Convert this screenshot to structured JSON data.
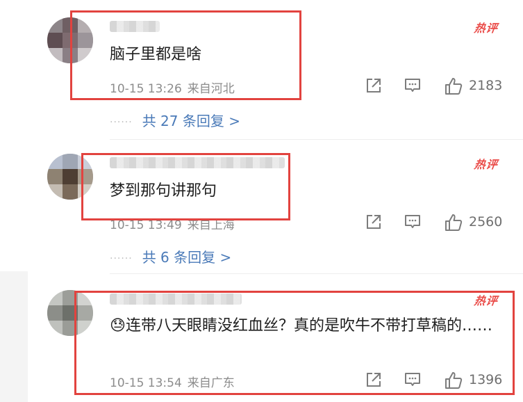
{
  "hot_label": "热评",
  "comments": [
    {
      "content": "脑子里都是啥",
      "time": "10-15 13:26",
      "location": "来自河北",
      "likes": "2183",
      "replies": "共 27 条回复 >"
    },
    {
      "content": "梦到那句讲那句",
      "time": "10-15 13:49",
      "location": "来自上海",
      "likes": "2560",
      "replies": "共 6 条回复 >"
    },
    {
      "emoji": "😓",
      "content": "连带八天眼睛没红血丝？真的是吹牛不带打草稿的……",
      "time": "10-15 13:54",
      "location": "来自广东",
      "likes": "1396"
    }
  ],
  "colors": {
    "highlight": "#e2433f",
    "hot": "#ea4b48",
    "reply_link": "#4a7ab8",
    "meta": "#8c8c8c"
  },
  "icons": [
    "share-icon",
    "comment-icon",
    "like-icon"
  ]
}
